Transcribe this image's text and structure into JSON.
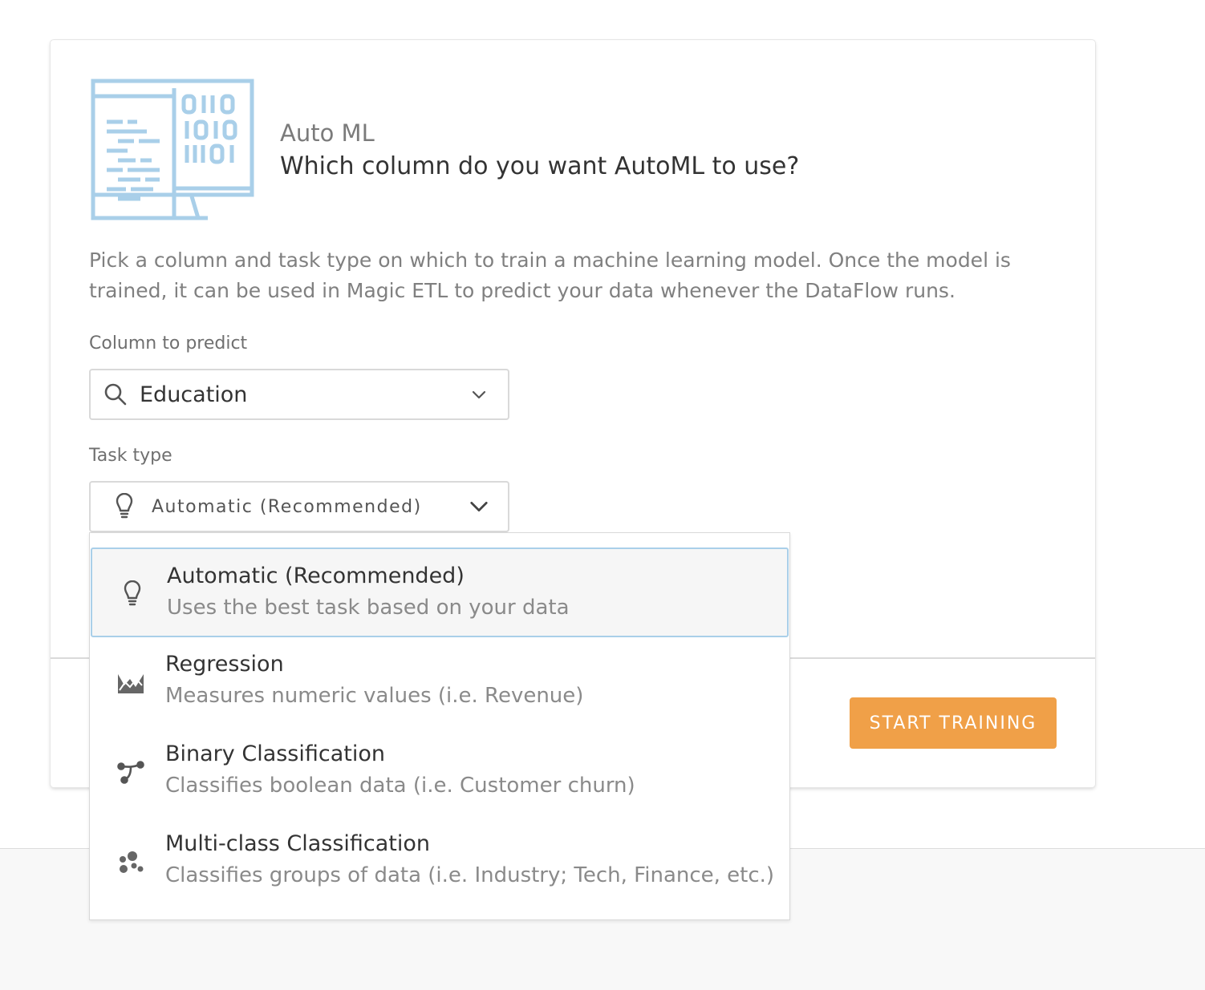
{
  "header": {
    "subtitle": "Auto ML",
    "title": "Which column do you want AutoML to use?",
    "illustration_icon": "binary-code-monitor-icon"
  },
  "description": "Pick a column and task type on which to train a machine learning model. Once the model is trained, it can be used in Magic ETL to predict your data whenever the DataFlow runs.",
  "column_field": {
    "label": "Column to predict",
    "value": "Education",
    "icon": "search-icon"
  },
  "task_field": {
    "label": "Task type",
    "value": "Automatic (Recommended)",
    "icon": "lightbulb-icon",
    "expanded": true
  },
  "task_options": [
    {
      "label": "Automatic (Recommended)",
      "description": "Uses the best task based on your data",
      "icon": "lightbulb-icon",
      "selected": true
    },
    {
      "label": "Regression",
      "description": "Measures numeric values (i.e. Revenue)",
      "icon": "area-chart-icon",
      "selected": false
    },
    {
      "label": "Binary Classification",
      "description": "Classifies boolean data (i.e. Customer churn)",
      "icon": "binary-split-icon",
      "selected": false
    },
    {
      "label": "Multi-class Classification",
      "description": "Classifies groups of data (i.e. Industry; Tech, Finance, etc.)",
      "icon": "cluster-dots-icon",
      "selected": false
    }
  ],
  "footer": {
    "start_label": "START TRAINING"
  },
  "colors": {
    "accent": "#f0a048",
    "illustration": "#a9cfe9",
    "selected_border": "#a9cfe9"
  }
}
